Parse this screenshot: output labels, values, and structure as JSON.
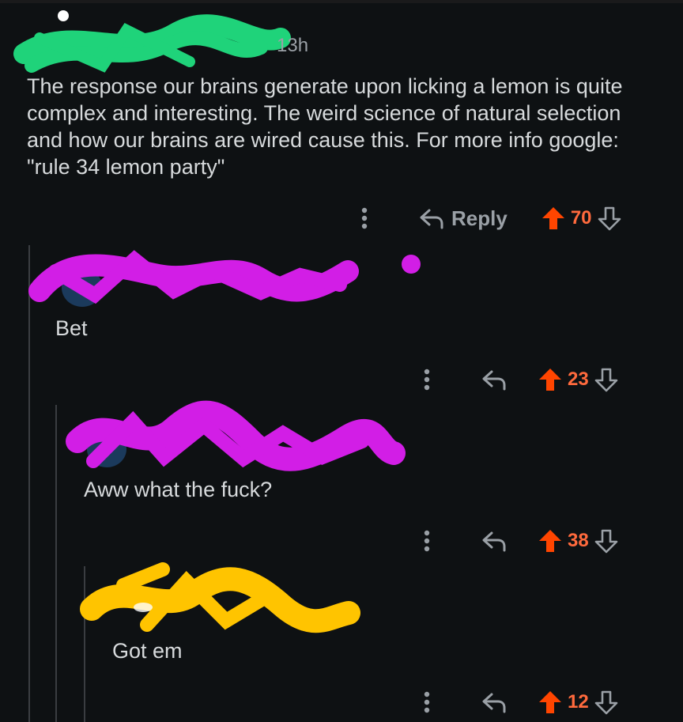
{
  "colors": {
    "background": "#0e1113",
    "text": "#d7dadc",
    "muted": "#9aa0a6",
    "upvote": "#ff4500",
    "count": "#ff6a3d",
    "redact_green": "#1fd37a",
    "redact_magenta": "#d21ee6",
    "redact_yellow": "#ffc400"
  },
  "comments": [
    {
      "timestamp": "13h",
      "body": "The response our brains generate upon licking a lemon is quite complex and interesting. The weird science of natural selection and how our brains are wired cause this. For more info google: \"rule 34 lemon party\"",
      "reply_label": "Reply",
      "votes": "70",
      "more_icon": "more-vertical-icon",
      "reply_icon": "reply-arrow-icon",
      "upvote_icon": "upvote-arrow-icon",
      "downvote_icon": "downvote-arrow-icon"
    },
    {
      "timestamp": "",
      "body": "Bet",
      "votes": "23"
    },
    {
      "timestamp": "",
      "body": "Aww what the fuck?",
      "votes": "38"
    },
    {
      "timestamp": "",
      "body": "Got em",
      "votes": "12"
    }
  ]
}
